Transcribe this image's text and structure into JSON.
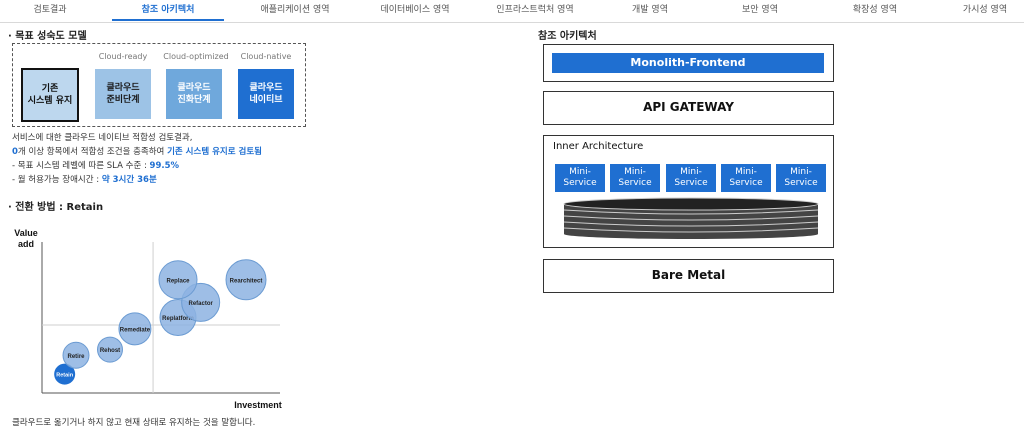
{
  "tabs": [
    {
      "label": "검토결과"
    },
    {
      "label": "참조 아키텍처"
    },
    {
      "label": "애플리케이션 영역"
    },
    {
      "label": "데이터베이스 영역"
    },
    {
      "label": "인프라스트럭처 영역"
    },
    {
      "label": "개발 영역"
    },
    {
      "label": "보안 영역"
    },
    {
      "label": "확장성 영역"
    },
    {
      "label": "가시성 영역"
    }
  ],
  "active_tab": "참조 아키텍처",
  "maturity": {
    "title": "· 목표 성숙도 모델",
    "stages": [
      {
        "top_label": "",
        "label": "기존\n시스템 유지"
      },
      {
        "top_label": "Cloud-ready",
        "label": "클라우드\n준비단계"
      },
      {
        "top_label": "Cloud-optimized",
        "label": "클라우드\n진화단계"
      },
      {
        "top_label": "Cloud-native",
        "label": "클라우드\n네이티브"
      }
    ]
  },
  "summary": {
    "line1": "서비스에 대한 클라우드 네이티브 적합성 검토결과,",
    "line2_count": "0",
    "line2_text": "개 이상 항목에서 적합성 조건을 충족하여 ",
    "line2_result": "기존 시스템 유지로 검토됨",
    "line3_label": "- 목표 시스템 레벨에 따른 SLA 수준 : ",
    "line3_value": "99.5%",
    "line4_label": "- 월 허용가능 장애시간 : ",
    "line4_value": "약 3시간 36분"
  },
  "transition": {
    "title": "· 전환 방법 : Retain",
    "footer": "클라우드로 옮기거나 하지 않고 현재 상태로 유지하는 것을 말합니다."
  },
  "chart_data": {
    "type": "scatter",
    "xlabel": "Investment",
    "ylabel_line1": "Value",
    "ylabel_line2": "add",
    "points": [
      {
        "label": "Retain",
        "x": 1.0,
        "y": 1.0,
        "size": 1.0,
        "highlight": true
      },
      {
        "label": "Retire",
        "x": 1.5,
        "y": 2.0,
        "size": 1.3,
        "highlight": false
      },
      {
        "label": "Rehost",
        "x": 3.0,
        "y": 2.3,
        "size": 1.25,
        "highlight": false
      },
      {
        "label": "Remediate",
        "x": 4.1,
        "y": 3.4,
        "size": 1.6,
        "highlight": false
      },
      {
        "label": "Replatform",
        "x": 6.0,
        "y": 4.0,
        "size": 1.8,
        "highlight": false
      },
      {
        "label": "Refactor",
        "x": 7.0,
        "y": 4.8,
        "size": 1.9,
        "highlight": false
      },
      {
        "label": "Replace",
        "x": 6.0,
        "y": 6.0,
        "size": 1.9,
        "highlight": false
      },
      {
        "label": "Rearchitect",
        "x": 9.0,
        "y": 6.0,
        "size": 2.0,
        "highlight": false
      }
    ],
    "xlim": [
      0,
      10.5
    ],
    "ylim": [
      0,
      8
    ],
    "divider_x": 4.9,
    "divider_y": 3.6,
    "colors": {
      "bubble": "#8db3e2",
      "bubble_stroke": "#6b9bd2",
      "highlight": "#1f6fd1"
    }
  },
  "architecture": {
    "title": "참조 아키텍처",
    "monolith": "Monolith-Frontend",
    "gateway": "API GATEWAY",
    "inner_title": "Inner Architecture",
    "services": [
      "Mini-\nService",
      "Mini-\nService",
      "Mini-\nService",
      "Mini-\nService",
      "Mini-\nService"
    ],
    "bare_metal": "Bare Metal"
  },
  "colors": {
    "accent": "#1f6fd1",
    "light_stage": "#bdd7ee",
    "mid_stage": "#7fb1e3"
  }
}
